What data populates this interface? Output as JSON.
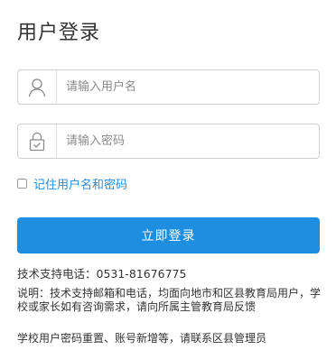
{
  "title": "用户登录",
  "username": {
    "icon": "user-icon",
    "placeholder": "请输入用户名",
    "value": ""
  },
  "password": {
    "icon": "lock-icon",
    "placeholder": "请输入密码",
    "value": ""
  },
  "remember": {
    "label": "记住用户名和密码",
    "checked": false
  },
  "login_button": "立即登录",
  "support": {
    "phone_line": "技术支持电话：0531-81676775",
    "note": "说明：技术支持邮箱和电话，均面向地市和区县教育局用户，学校或家长如有咨询需求，请向所属主管教育局反馈",
    "reset": "学校用户密码重置、账号新增等，请联系区县管理员"
  },
  "colors": {
    "accent": "#1e8ee0",
    "link": "#2a8ad9"
  }
}
